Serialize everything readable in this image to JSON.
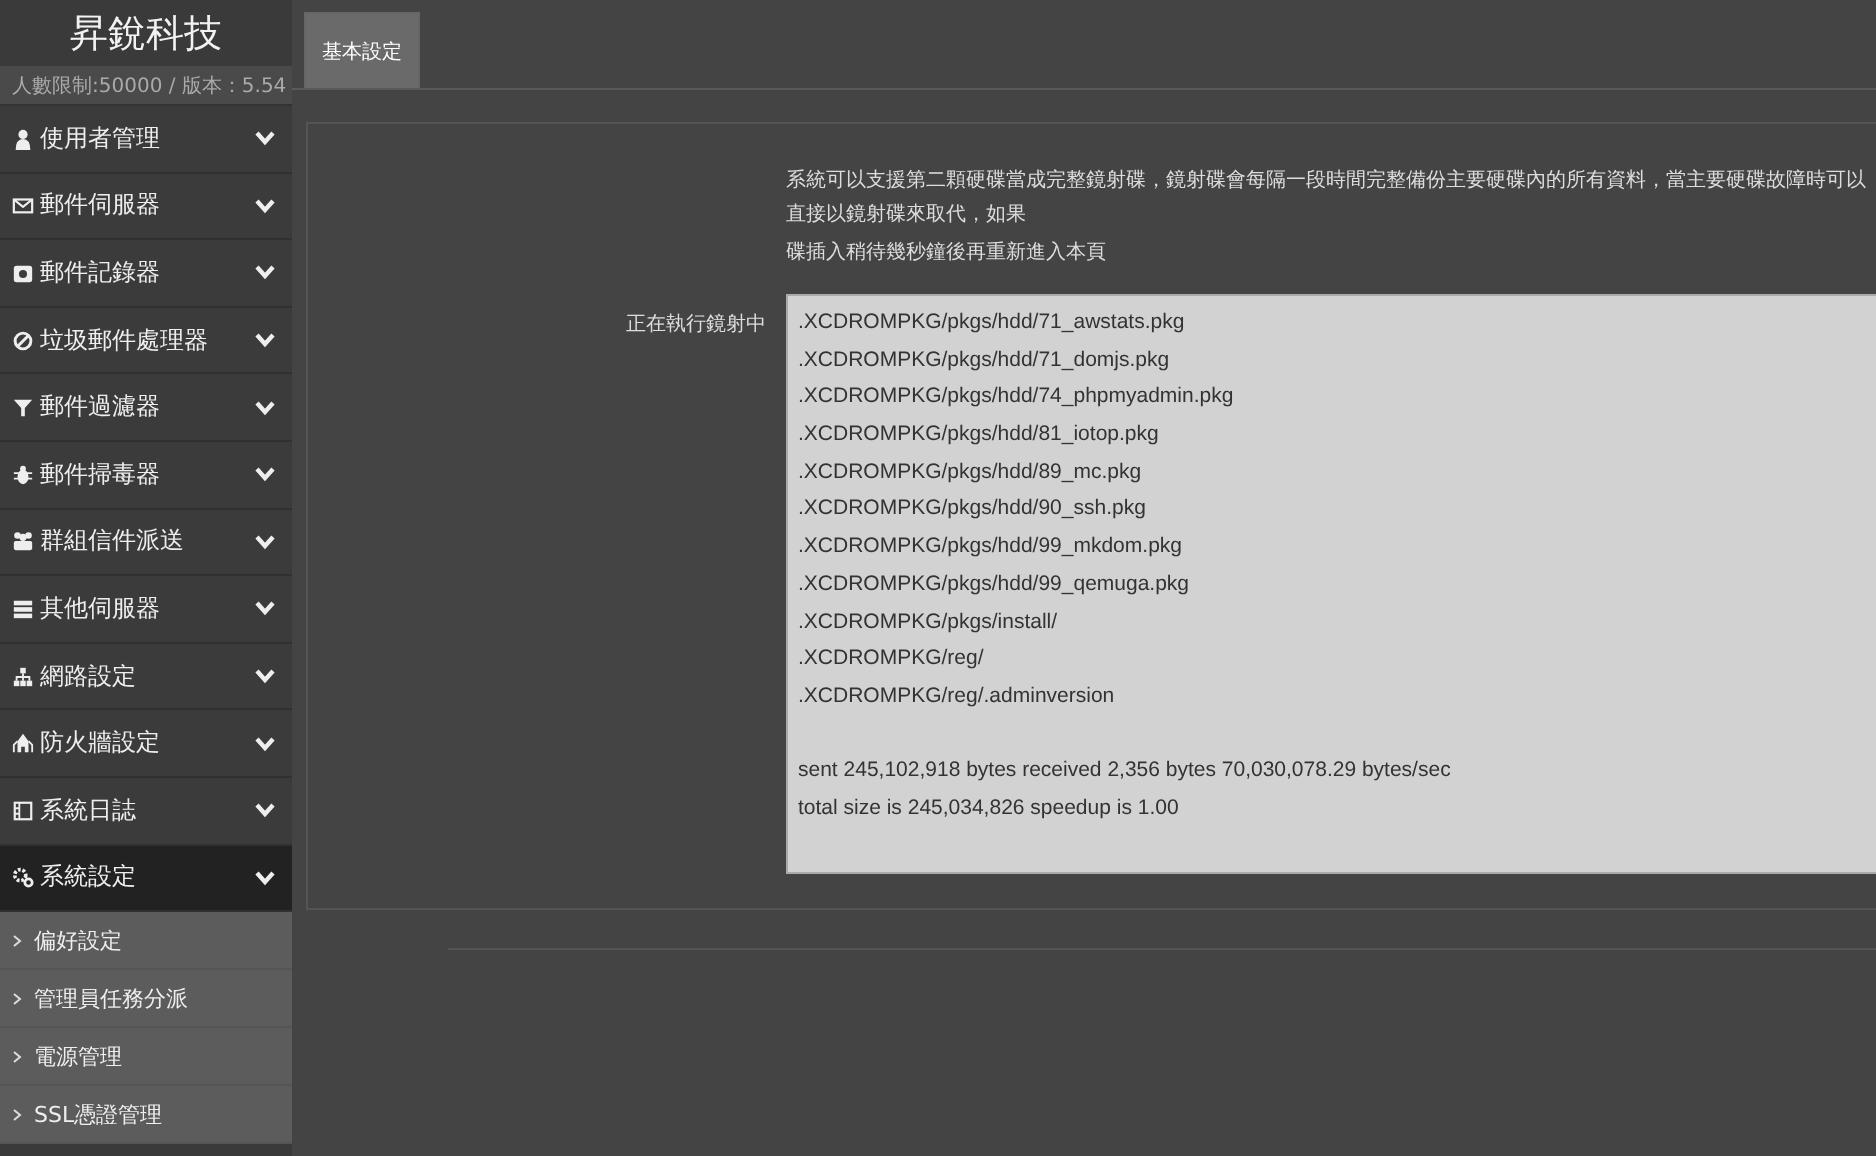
{
  "sidebar": {
    "brand": "昇銳科技",
    "info": "人數限制:50000 / 版本：5.54",
    "items": [
      {
        "label": "使用者管理",
        "selected": false
      },
      {
        "label": "郵件伺服器",
        "selected": false
      },
      {
        "label": "郵件記錄器",
        "selected": false
      },
      {
        "label": "垃圾郵件處理器",
        "selected": false
      },
      {
        "label": "郵件過濾器",
        "selected": false
      },
      {
        "label": "郵件掃毒器",
        "selected": false
      },
      {
        "label": "群組信件派送",
        "selected": false
      },
      {
        "label": "其他伺服器",
        "selected": false
      },
      {
        "label": "網路設定",
        "selected": false
      },
      {
        "label": "防火牆設定",
        "selected": false
      },
      {
        "label": "系統日誌",
        "selected": false
      },
      {
        "label": "系統設定",
        "selected": true,
        "children": [
          {
            "label": "偏好設定"
          },
          {
            "label": "管理員任務分派"
          },
          {
            "label": "電源管理"
          },
          {
            "label": "SSL憑證管理"
          }
        ]
      }
    ]
  },
  "tabs": [
    {
      "label": "基本設定",
      "selected": true
    }
  ],
  "panel": {
    "description": [
      "系統可以支援第二顆硬碟當成完整鏡射碟，鏡射碟會每隔一段時間完整備份主要硬碟內的所有資料，當主要硬碟故障時可以直接以鏡射碟來取代，如果",
      "碟插入稍待幾秒鐘後再重新進入本頁"
    ],
    "field_label": "正在執行鏡射中",
    "log_lines": [
      ".XCDROMPKG/pkgs/hdd/71_awstats.pkg",
      ".XCDROMPKG/pkgs/hdd/71_domjs.pkg",
      ".XCDROMPKG/pkgs/hdd/74_phpmyadmin.pkg",
      ".XCDROMPKG/pkgs/hdd/81_iotop.pkg",
      ".XCDROMPKG/pkgs/hdd/89_mc.pkg",
      ".XCDROMPKG/pkgs/hdd/90_ssh.pkg",
      ".XCDROMPKG/pkgs/hdd/99_mkdom.pkg",
      ".XCDROMPKG/pkgs/hdd/99_qemuga.pkg",
      ".XCDROMPKG/pkgs/install/",
      ".XCDROMPKG/reg/",
      ".XCDROMPKG/reg/.adminversion"
    ],
    "summary_lines": [
      "sent 245,102,918 bytes  received 2,356 bytes  70,030,078.29 bytes/sec",
      "total size is 245,034,826  speedup is 1.00"
    ]
  }
}
